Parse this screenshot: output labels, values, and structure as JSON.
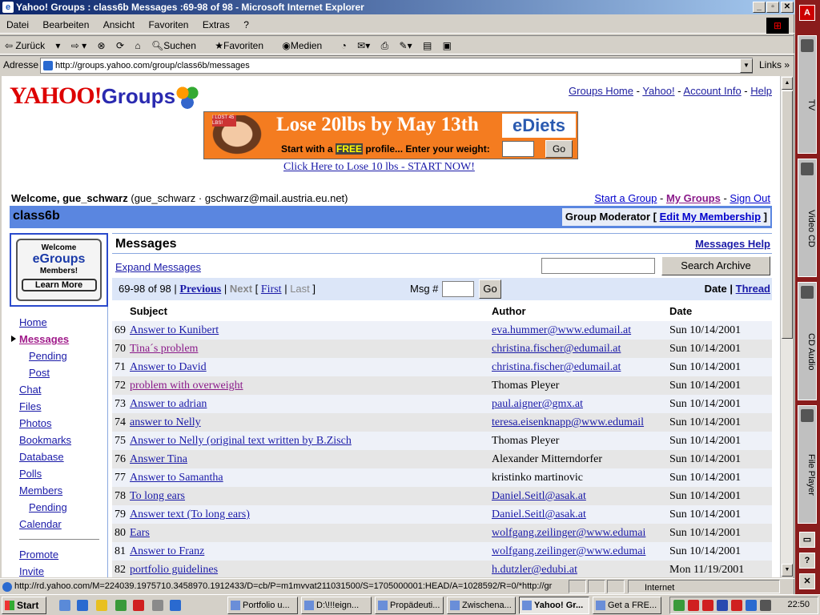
{
  "window": {
    "title": "Yahoo! Groups : class6b Messages :69-98 of 98 - Microsoft Internet Explorer"
  },
  "menu": [
    "Datei",
    "Bearbeiten",
    "Ansicht",
    "Favoriten",
    "Extras",
    "?"
  ],
  "toolbar": {
    "back": "Zurück",
    "search": "Suchen",
    "favorites": "Favoriten",
    "media": "Medien"
  },
  "address": {
    "label": "Adresse",
    "url": "http://groups.yahoo.com/group/class6b/messages",
    "links": "Links"
  },
  "header": {
    "logo_yahoo": "YAHOO!",
    "logo_groups": "Groups",
    "links": [
      "Groups Home",
      "Yahoo!",
      "Account Info",
      "Help"
    ]
  },
  "ad": {
    "headline": "Lose 20lbs by May 13th",
    "badge": "I LOST 45 LBS!",
    "brand": "eDiets",
    "sub_pre": "Start with a",
    "sub_free": "FREE",
    "sub_post": "profile... Enter your weight:",
    "go": "Go",
    "promo_link": "Click Here to Lose 10 lbs - START NOW!"
  },
  "welcome": {
    "prefix": "Welcome,",
    "user": "gue_schwarz",
    "detail": "(gue_schwarz · gschwarz@mail.austria.eu.net)"
  },
  "user_links": [
    "Start a Group",
    "My Groups",
    "Sign Out"
  ],
  "group": {
    "name": "class6b",
    "role": "Group Moderator",
    "edit": "Edit My Membership"
  },
  "promo_box": {
    "welcome": "Welcome",
    "brand": "eGroups",
    "members": "Members!",
    "learn": "Learn More"
  },
  "nav": [
    {
      "label": "Home",
      "sub": false,
      "current": false
    },
    {
      "label": "Messages",
      "sub": false,
      "current": true
    },
    {
      "label": "Pending",
      "sub": true,
      "current": false
    },
    {
      "label": "Post",
      "sub": true,
      "current": false
    },
    {
      "label": "Chat",
      "sub": false,
      "current": false
    },
    {
      "label": "Files",
      "sub": false,
      "current": false
    },
    {
      "label": "Photos",
      "sub": false,
      "current": false
    },
    {
      "label": "Bookmarks",
      "sub": false,
      "current": false
    },
    {
      "label": "Database",
      "sub": false,
      "current": false
    },
    {
      "label": "Polls",
      "sub": false,
      "current": false
    },
    {
      "label": "Members",
      "sub": false,
      "current": false
    },
    {
      "label": "Pending",
      "sub": true,
      "current": false
    },
    {
      "label": "Calendar",
      "sub": false,
      "current": false
    }
  ],
  "nav_bottom": [
    "Promote",
    "Invite"
  ],
  "messages": {
    "title": "Messages",
    "help": "Messages Help",
    "expand": "Expand Messages",
    "search_btn": "Search Archive",
    "range": "69-98 of 98",
    "previous": "Previous",
    "next": "Next",
    "first": "First",
    "last": "Last",
    "msg_label": "Msg #",
    "go": "Go",
    "sort_date": "Date",
    "sort_thread": "Thread",
    "col_subject": "Subject",
    "col_author": "Author",
    "col_date": "Date",
    "rows": [
      {
        "n": "69",
        "subject": "Answer to Kunibert",
        "visited": false,
        "author": "eva.hummer@www.edumail.at",
        "author_link": true,
        "date": "Sun  10/14/2001"
      },
      {
        "n": "70",
        "subject": "Tina´s problem",
        "visited": true,
        "author": "christina.fischer@edumail.at",
        "author_link": true,
        "date": "Sun  10/14/2001"
      },
      {
        "n": "71",
        "subject": "Answer to David",
        "visited": false,
        "author": "christina.fischer@edumail.at",
        "author_link": true,
        "date": "Sun  10/14/2001"
      },
      {
        "n": "72",
        "subject": "problem with overweight",
        "visited": true,
        "author": "Thomas Pleyer",
        "author_link": false,
        "date": "Sun  10/14/2001"
      },
      {
        "n": "73",
        "subject": "Answer to adrian",
        "visited": false,
        "author": "paul.aigner@gmx.at",
        "author_link": true,
        "date": "Sun  10/14/2001"
      },
      {
        "n": "74",
        "subject": "answer to Nelly",
        "visited": false,
        "author": "teresa.eisenknapp@www.edumail",
        "author_link": true,
        "date": "Sun  10/14/2001"
      },
      {
        "n": "75",
        "subject": "Answer to Nelly (original text written by B.Zisch",
        "visited": false,
        "author": "Thomas Pleyer",
        "author_link": false,
        "date": "Sun  10/14/2001"
      },
      {
        "n": "76",
        "subject": "Answer Tina",
        "visited": false,
        "author": "Alexander Mitterndorfer",
        "author_link": false,
        "date": "Sun  10/14/2001"
      },
      {
        "n": "77",
        "subject": "Answer to Samantha",
        "visited": false,
        "author": "kristinko martinovic",
        "author_link": false,
        "date": "Sun  10/14/2001"
      },
      {
        "n": "78",
        "subject": "To long ears",
        "visited": false,
        "author": "Daniel.Seitl@asak.at",
        "author_link": true,
        "date": "Sun  10/14/2001"
      },
      {
        "n": "79",
        "subject": "Answer text (To long ears)",
        "visited": false,
        "author": "Daniel.Seitl@asak.at",
        "author_link": true,
        "date": "Sun  10/14/2001"
      },
      {
        "n": "80",
        "subject": "Ears",
        "visited": false,
        "author": "wolfgang.zeilinger@www.edumai",
        "author_link": true,
        "date": "Sun  10/14/2001"
      },
      {
        "n": "81",
        "subject": "Answer to Franz",
        "visited": false,
        "author": "wolfgang.zeilinger@www.edumai",
        "author_link": true,
        "date": "Sun  10/14/2001"
      },
      {
        "n": "82",
        "subject": "portfolio guidelines",
        "visited": false,
        "author": "h.dutzler@edubi.at",
        "author_link": true,
        "date": "Mon  11/19/2001"
      }
    ]
  },
  "status": {
    "url": "http://rd.yahoo.com/M=224039.1975710.3458970.1912433/D=cb/P=m1mvvat211031500/S=1705000001:HEAD/A=1028592/R=0/*http://gr",
    "zone": "Internet"
  },
  "taskbar": {
    "start": "Start",
    "tasks": [
      "Portfolio u...",
      "D:\\!!!eign...",
      "Propädeuti...",
      "Zwischena...",
      "Yahoo! Gr...",
      "Get a FRE..."
    ],
    "active_index": 4,
    "clock": "22:50"
  },
  "dock": [
    "TV",
    "Video CD",
    "CD Audio",
    "File Player"
  ]
}
